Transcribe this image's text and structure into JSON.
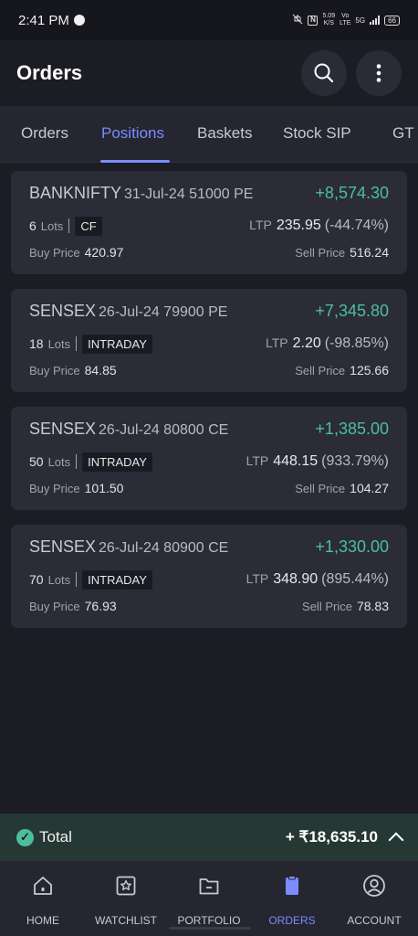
{
  "status_bar": {
    "time": "2:41 PM",
    "speed_value": "5.09",
    "speed_unit": "K/S",
    "volte": "Vo",
    "volte2": "LTE",
    "network": "5G",
    "battery": "66"
  },
  "header": {
    "title": "Orders"
  },
  "tabs": [
    {
      "label": "Orders",
      "active": false
    },
    {
      "label": "Positions",
      "active": true
    },
    {
      "label": "Baskets",
      "active": false
    },
    {
      "label": "Stock SIP",
      "active": false
    },
    {
      "label": "GT",
      "active": false
    }
  ],
  "positions": [
    {
      "symbol": "BANKNIFTY",
      "contract": "31-Jul-24 51000 PE",
      "pnl": "+8,574.30",
      "lots": "6",
      "lots_label": "Lots",
      "product": "CF",
      "ltp_label": "LTP",
      "ltp": "235.95",
      "ltp_change": "(-44.74%)",
      "buy_label": "Buy Price",
      "buy_price": "420.97",
      "sell_label": "Sell Price",
      "sell_price": "516.24"
    },
    {
      "symbol": "SENSEX",
      "contract": "26-Jul-24 79900 PE",
      "pnl": "+7,345.80",
      "lots": "18",
      "lots_label": "Lots",
      "product": "INTRADAY",
      "ltp_label": "LTP",
      "ltp": "2.20",
      "ltp_change": "(-98.85%)",
      "buy_label": "Buy Price",
      "buy_price": "84.85",
      "sell_label": "Sell Price",
      "sell_price": "125.66"
    },
    {
      "symbol": "SENSEX",
      "contract": "26-Jul-24 80800 CE",
      "pnl": "+1,385.00",
      "lots": "50",
      "lots_label": "Lots",
      "product": "INTRADAY",
      "ltp_label": "LTP",
      "ltp": "448.15",
      "ltp_change": "(933.79%)",
      "buy_label": "Buy Price",
      "buy_price": "101.50",
      "sell_label": "Sell Price",
      "sell_price": "104.27"
    },
    {
      "symbol": "SENSEX",
      "contract": "26-Jul-24 80900 CE",
      "pnl": "+1,330.00",
      "lots": "70",
      "lots_label": "Lots",
      "product": "INTRADAY",
      "ltp_label": "LTP",
      "ltp": "348.90",
      "ltp_change": "(895.44%)",
      "buy_label": "Buy Price",
      "buy_price": "76.93",
      "sell_label": "Sell Price",
      "sell_price": "78.83"
    }
  ],
  "total": {
    "label": "Total",
    "value": "+ ₹18,635.10"
  },
  "bottom_nav": [
    {
      "label": "HOME",
      "icon": "home-icon",
      "active": false
    },
    {
      "label": "WATCHLIST",
      "icon": "watchlist-icon",
      "active": false
    },
    {
      "label": "PORTFOLIO",
      "icon": "portfolio-icon",
      "active": false
    },
    {
      "label": "ORDERS",
      "icon": "orders-icon",
      "active": true
    },
    {
      "label": "ACCOUNT",
      "icon": "account-icon",
      "active": false
    }
  ],
  "colors": {
    "accent": "#7b8cff",
    "profit": "#4cbf9a",
    "background": "#1c1c24",
    "card": "#2b2c38"
  }
}
